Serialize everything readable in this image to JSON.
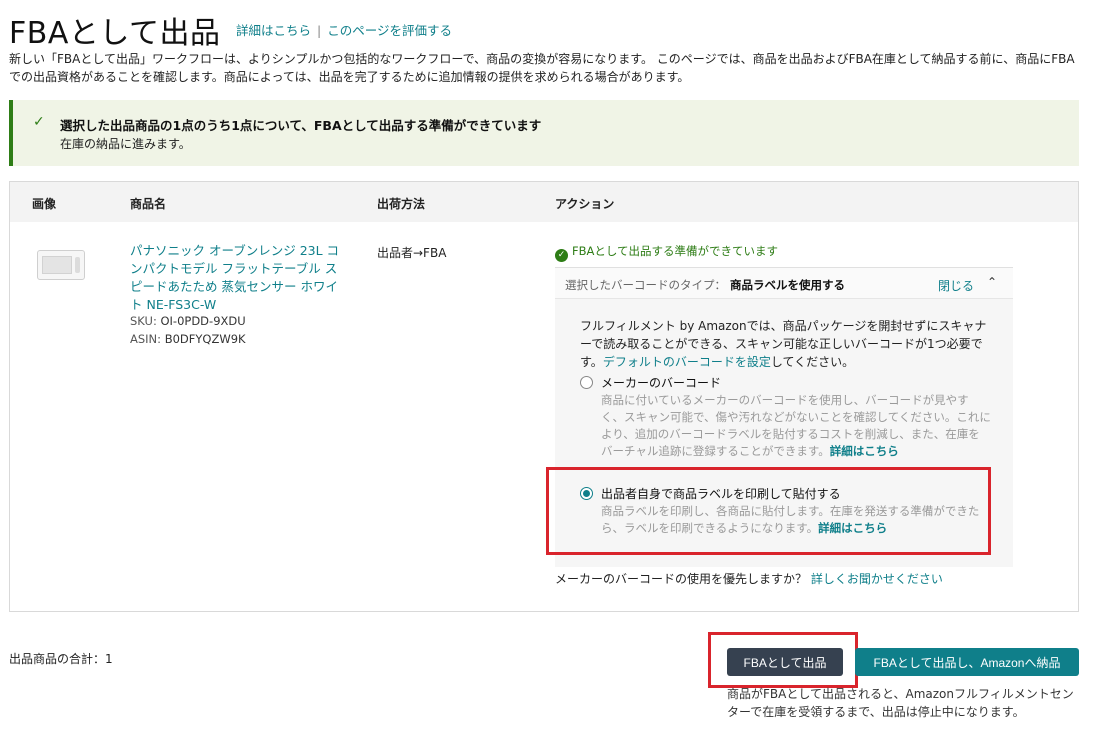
{
  "header": {
    "title": "FBAとして出品",
    "details_link": "詳細はこちら",
    "separator": "|",
    "rate_link": "このページを評価する",
    "intro": "新しい「FBAとして出品」ワークフローは、よりシンプルかつ包括的なワークフローで、商品の変換が容易になります。 このページでは、商品を出品およびFBA在庫として納品する前に、商品にFBAでの出品資格があることを確認します。商品によっては、出品を完了するために追加情報の提供を求められる場合があります。"
  },
  "banner": {
    "icon": "check-icon",
    "title": "選択した出品商品の1点のうち1点について、FBAとして出品する準備ができています",
    "subtitle": "在庫の納品に進みます。"
  },
  "table": {
    "headers": {
      "image": "画像",
      "name": "商品名",
      "shipping": "出荷方法",
      "action": "アクション"
    },
    "row": {
      "image_icon": "microwave-image",
      "product_name": "パナソニック オーブンレンジ 23L コンパクトモデル フラットテーブル スピードあたため 蒸気センサー ホワイト NE-FS3C-W",
      "sku_label": "SKU:",
      "sku": "OI-0PDD-9XDU",
      "asin_label": "ASIN:",
      "asin": "B0DFYQZW9K",
      "shipping_method": "出品者→FBA",
      "ready_text": "FBAとして出品する準備ができています",
      "barcode": {
        "type_label": "選択したバーコードのタイプ：",
        "type_value": "商品ラベルを使用する",
        "close_label": "閉じる",
        "chevron_icon": "chevron-up-icon",
        "fulfillment_text": "フルフィルメント by Amazonでは、商品パッケージを開封せずにスキャナーで読み取ることができる、スキャン可能な正しいバーコードが1つ必要です。",
        "default_link": "デフォルトのバーコードを設定",
        "fulfillment_suffix": "してください。",
        "option1": {
          "title": "メーカーのバーコード",
          "desc": "商品に付いているメーカーのバーコードを使用し、バーコードが見やすく、スキャン可能で、傷や汚れなどがないことを確認してください。これにより、追加のバーコードラベルを貼付するコストを削減し、また、在庫をバーチャル追跡に登録することができます。",
          "link": "詳細はこちら",
          "selected": false
        },
        "option2": {
          "title": "出品者自身で商品ラベルを印刷して貼付する",
          "desc": "商品ラベルを印刷し、各商品に貼付します。在庫を発送する準備ができたら、ラベルを印刷できるようになります。",
          "link": "詳細はこちら",
          "selected": true
        },
        "prefer_text": "メーカーのバーコードの使用を優先しますか？",
        "prefer_link": "詳しくお聞かせください"
      }
    }
  },
  "footer": {
    "total": "出品商品の合計：1",
    "list_fba_button": "FBAとして出品",
    "list_send_button": "FBAとして出品し、Amazonへ納品",
    "note": "商品がFBAとして出品されると、Amazonフルフィルメントセンターで在庫を受領するまで、出品は停止中になります。"
  },
  "colors": {
    "accent": "#0f7f8a",
    "success": "#2e7d16",
    "highlight": "#d9242c",
    "dark_button": "#364150"
  }
}
